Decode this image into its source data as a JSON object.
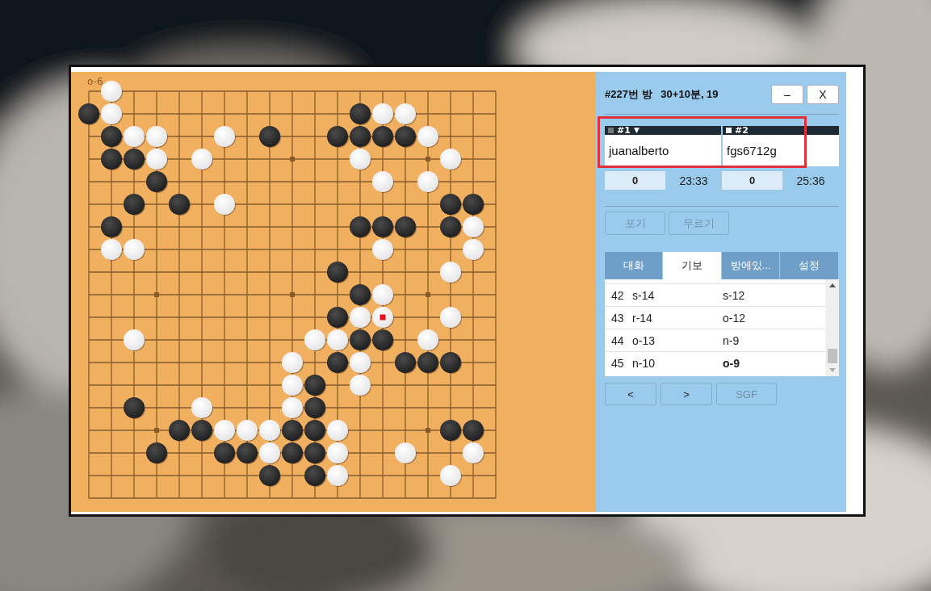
{
  "board": {
    "hover_label": "o-6",
    "rows": [
      {
        "points": [
          {
            "kind": "none"
          },
          {
            "kind": "white"
          },
          {
            "kind": "none"
          },
          {
            "kind": "none"
          },
          {
            "kind": "none"
          },
          {
            "kind": "none"
          },
          {
            "kind": "none"
          },
          {
            "kind": "none"
          },
          {
            "kind": "none"
          },
          {
            "kind": "none"
          },
          {
            "kind": "none"
          },
          {
            "kind": "none"
          },
          {
            "kind": "none"
          },
          {
            "kind": "none"
          },
          {
            "kind": "none"
          },
          {
            "kind": "none"
          },
          {
            "kind": "none"
          },
          {
            "kind": "none"
          },
          {
            "kind": "none"
          }
        ]
      },
      {
        "points": [
          {
            "kind": "black"
          },
          {
            "kind": "white"
          },
          {
            "kind": "none"
          },
          {
            "kind": "none"
          },
          {
            "kind": "none"
          },
          {
            "kind": "none"
          },
          {
            "kind": "none"
          },
          {
            "kind": "none"
          },
          {
            "kind": "none"
          },
          {
            "kind": "none"
          },
          {
            "kind": "none"
          },
          {
            "kind": "none"
          },
          {
            "kind": "black"
          },
          {
            "kind": "white"
          },
          {
            "kind": "white"
          },
          {
            "kind": "none"
          },
          {
            "kind": "none"
          },
          {
            "kind": "none"
          },
          {
            "kind": "none"
          }
        ]
      },
      {
        "points": [
          {
            "kind": "none"
          },
          {
            "kind": "black"
          },
          {
            "kind": "white"
          },
          {
            "kind": "white"
          },
          {
            "kind": "none"
          },
          {
            "kind": "none"
          },
          {
            "kind": "white"
          },
          {
            "kind": "none"
          },
          {
            "kind": "black"
          },
          {
            "kind": "none"
          },
          {
            "kind": "none"
          },
          {
            "kind": "black"
          },
          {
            "kind": "black"
          },
          {
            "kind": "black"
          },
          {
            "kind": "black"
          },
          {
            "kind": "white"
          },
          {
            "kind": "none"
          },
          {
            "kind": "none"
          },
          {
            "kind": "none"
          }
        ]
      },
      {
        "points": [
          {
            "kind": "none"
          },
          {
            "kind": "black"
          },
          {
            "kind": "black"
          },
          {
            "kind": "white"
          },
          {
            "kind": "none"
          },
          {
            "kind": "white"
          },
          {
            "kind": "none"
          },
          {
            "kind": "none"
          },
          {
            "kind": "none"
          },
          {
            "kind": "none"
          },
          {
            "kind": "none"
          },
          {
            "kind": "none"
          },
          {
            "kind": "white"
          },
          {
            "kind": "none"
          },
          {
            "kind": "none"
          },
          {
            "kind": "none"
          },
          {
            "kind": "white"
          },
          {
            "kind": "none"
          },
          {
            "kind": "none"
          }
        ]
      },
      {
        "points": [
          {
            "kind": "none"
          },
          {
            "kind": "none"
          },
          {
            "kind": "none"
          },
          {
            "kind": "black"
          },
          {
            "kind": "none"
          },
          {
            "kind": "none"
          },
          {
            "kind": "none"
          },
          {
            "kind": "none"
          },
          {
            "kind": "none"
          },
          {
            "kind": "none"
          },
          {
            "kind": "none"
          },
          {
            "kind": "none"
          },
          {
            "kind": "none"
          },
          {
            "kind": "white"
          },
          {
            "kind": "none"
          },
          {
            "kind": "white"
          },
          {
            "kind": "none"
          },
          {
            "kind": "none"
          },
          {
            "kind": "none"
          }
        ]
      },
      {
        "points": [
          {
            "kind": "none"
          },
          {
            "kind": "none"
          },
          {
            "kind": "black"
          },
          {
            "kind": "none"
          },
          {
            "kind": "black"
          },
          {
            "kind": "none"
          },
          {
            "kind": "white"
          },
          {
            "kind": "none"
          },
          {
            "kind": "none"
          },
          {
            "kind": "none"
          },
          {
            "kind": "none"
          },
          {
            "kind": "none"
          },
          {
            "kind": "none"
          },
          {
            "kind": "none"
          },
          {
            "kind": "none"
          },
          {
            "kind": "none"
          },
          {
            "kind": "black"
          },
          {
            "kind": "black"
          },
          {
            "kind": "none"
          }
        ]
      },
      {
        "points": [
          {
            "kind": "none"
          },
          {
            "kind": "black"
          },
          {
            "kind": "none"
          },
          {
            "kind": "none"
          },
          {
            "kind": "none"
          },
          {
            "kind": "none"
          },
          {
            "kind": "none"
          },
          {
            "kind": "none"
          },
          {
            "kind": "none"
          },
          {
            "kind": "none"
          },
          {
            "kind": "none"
          },
          {
            "kind": "none"
          },
          {
            "kind": "black"
          },
          {
            "kind": "black"
          },
          {
            "kind": "black"
          },
          {
            "kind": "none"
          },
          {
            "kind": "black"
          },
          {
            "kind": "white"
          },
          {
            "kind": "none"
          }
        ]
      },
      {
        "points": [
          {
            "kind": "none"
          },
          {
            "kind": "white"
          },
          {
            "kind": "white"
          },
          {
            "kind": "none"
          },
          {
            "kind": "none"
          },
          {
            "kind": "none"
          },
          {
            "kind": "none"
          },
          {
            "kind": "none"
          },
          {
            "kind": "none"
          },
          {
            "kind": "none"
          },
          {
            "kind": "none"
          },
          {
            "kind": "none"
          },
          {
            "kind": "none"
          },
          {
            "kind": "white"
          },
          {
            "kind": "none"
          },
          {
            "kind": "none"
          },
          {
            "kind": "none"
          },
          {
            "kind": "white"
          },
          {
            "kind": "none"
          }
        ]
      },
      {
        "points": [
          {
            "kind": "none"
          },
          {
            "kind": "none"
          },
          {
            "kind": "none"
          },
          {
            "kind": "none"
          },
          {
            "kind": "none"
          },
          {
            "kind": "none"
          },
          {
            "kind": "none"
          },
          {
            "kind": "none"
          },
          {
            "kind": "none"
          },
          {
            "kind": "none"
          },
          {
            "kind": "none"
          },
          {
            "kind": "black"
          },
          {
            "kind": "none"
          },
          {
            "kind": "none"
          },
          {
            "kind": "none"
          },
          {
            "kind": "none"
          },
          {
            "kind": "white"
          },
          {
            "kind": "none"
          },
          {
            "kind": "none"
          }
        ]
      },
      {
        "points": [
          {
            "kind": "none"
          },
          {
            "kind": "none"
          },
          {
            "kind": "none"
          },
          {
            "kind": "none"
          },
          {
            "kind": "none"
          },
          {
            "kind": "none"
          },
          {
            "kind": "none"
          },
          {
            "kind": "none"
          },
          {
            "kind": "none"
          },
          {
            "kind": "none"
          },
          {
            "kind": "none"
          },
          {
            "kind": "none"
          },
          {
            "kind": "black"
          },
          {
            "kind": "white"
          },
          {
            "kind": "none"
          },
          {
            "kind": "none"
          },
          {
            "kind": "none"
          },
          {
            "kind": "none"
          },
          {
            "kind": "none"
          }
        ]
      },
      {
        "points": [
          {
            "kind": "none"
          },
          {
            "kind": "none"
          },
          {
            "kind": "none"
          },
          {
            "kind": "none"
          },
          {
            "kind": "none"
          },
          {
            "kind": "none"
          },
          {
            "kind": "none"
          },
          {
            "kind": "none"
          },
          {
            "kind": "none"
          },
          {
            "kind": "none"
          },
          {
            "kind": "none"
          },
          {
            "kind": "black"
          },
          {
            "kind": "white"
          },
          {
            "kind": "white",
            "last": true
          },
          {
            "kind": "none"
          },
          {
            "kind": "none"
          },
          {
            "kind": "white"
          },
          {
            "kind": "none"
          },
          {
            "kind": "none"
          }
        ]
      },
      {
        "points": [
          {
            "kind": "none"
          },
          {
            "kind": "none"
          },
          {
            "kind": "white"
          },
          {
            "kind": "none"
          },
          {
            "kind": "none"
          },
          {
            "kind": "none"
          },
          {
            "kind": "none"
          },
          {
            "kind": "none"
          },
          {
            "kind": "none"
          },
          {
            "kind": "none"
          },
          {
            "kind": "white"
          },
          {
            "kind": "white"
          },
          {
            "kind": "black"
          },
          {
            "kind": "black"
          },
          {
            "kind": "none"
          },
          {
            "kind": "white"
          },
          {
            "kind": "none"
          },
          {
            "kind": "none"
          },
          {
            "kind": "none"
          }
        ]
      },
      {
        "points": [
          {
            "kind": "none"
          },
          {
            "kind": "none"
          },
          {
            "kind": "none"
          },
          {
            "kind": "none"
          },
          {
            "kind": "none"
          },
          {
            "kind": "none"
          },
          {
            "kind": "none"
          },
          {
            "kind": "none"
          },
          {
            "kind": "none"
          },
          {
            "kind": "white"
          },
          {
            "kind": "none"
          },
          {
            "kind": "black"
          },
          {
            "kind": "white"
          },
          {
            "kind": "none"
          },
          {
            "kind": "black"
          },
          {
            "kind": "black"
          },
          {
            "kind": "black"
          },
          {
            "kind": "none"
          },
          {
            "kind": "none"
          }
        ]
      },
      {
        "points": [
          {
            "kind": "none"
          },
          {
            "kind": "none"
          },
          {
            "kind": "none"
          },
          {
            "kind": "none"
          },
          {
            "kind": "none"
          },
          {
            "kind": "none"
          },
          {
            "kind": "none"
          },
          {
            "kind": "none"
          },
          {
            "kind": "none"
          },
          {
            "kind": "white"
          },
          {
            "kind": "black"
          },
          {
            "kind": "none"
          },
          {
            "kind": "white"
          },
          {
            "kind": "none"
          },
          {
            "kind": "none"
          },
          {
            "kind": "none"
          },
          {
            "kind": "none"
          },
          {
            "kind": "none"
          },
          {
            "kind": "none"
          }
        ]
      },
      {
        "points": [
          {
            "kind": "none"
          },
          {
            "kind": "none"
          },
          {
            "kind": "black"
          },
          {
            "kind": "none"
          },
          {
            "kind": "none"
          },
          {
            "kind": "white"
          },
          {
            "kind": "none"
          },
          {
            "kind": "none"
          },
          {
            "kind": "none"
          },
          {
            "kind": "white"
          },
          {
            "kind": "black"
          },
          {
            "kind": "none"
          },
          {
            "kind": "none"
          },
          {
            "kind": "none"
          },
          {
            "kind": "none"
          },
          {
            "kind": "none"
          },
          {
            "kind": "none"
          },
          {
            "kind": "none"
          },
          {
            "kind": "none"
          }
        ]
      },
      {
        "points": [
          {
            "kind": "none"
          },
          {
            "kind": "none"
          },
          {
            "kind": "none"
          },
          {
            "kind": "none"
          },
          {
            "kind": "black"
          },
          {
            "kind": "black"
          },
          {
            "kind": "white"
          },
          {
            "kind": "white"
          },
          {
            "kind": "white"
          },
          {
            "kind": "black"
          },
          {
            "kind": "black"
          },
          {
            "kind": "white"
          },
          {
            "kind": "none"
          },
          {
            "kind": "none"
          },
          {
            "kind": "none"
          },
          {
            "kind": "none"
          },
          {
            "kind": "black"
          },
          {
            "kind": "black"
          },
          {
            "kind": "none"
          }
        ]
      },
      {
        "points": [
          {
            "kind": "none"
          },
          {
            "kind": "none"
          },
          {
            "kind": "none"
          },
          {
            "kind": "black"
          },
          {
            "kind": "none"
          },
          {
            "kind": "none"
          },
          {
            "kind": "black"
          },
          {
            "kind": "black"
          },
          {
            "kind": "white"
          },
          {
            "kind": "black"
          },
          {
            "kind": "black"
          },
          {
            "kind": "white"
          },
          {
            "kind": "none"
          },
          {
            "kind": "none"
          },
          {
            "kind": "white"
          },
          {
            "kind": "none"
          },
          {
            "kind": "none"
          },
          {
            "kind": "white"
          },
          {
            "kind": "none"
          }
        ]
      },
      {
        "points": [
          {
            "kind": "none"
          },
          {
            "kind": "none"
          },
          {
            "kind": "none"
          },
          {
            "kind": "none"
          },
          {
            "kind": "none"
          },
          {
            "kind": "none"
          },
          {
            "kind": "none"
          },
          {
            "kind": "none"
          },
          {
            "kind": "black"
          },
          {
            "kind": "none"
          },
          {
            "kind": "black"
          },
          {
            "kind": "white"
          },
          {
            "kind": "none"
          },
          {
            "kind": "none"
          },
          {
            "kind": "none"
          },
          {
            "kind": "none"
          },
          {
            "kind": "white"
          },
          {
            "kind": "none"
          },
          {
            "kind": "none"
          }
        ]
      },
      {
        "points": [
          {
            "kind": "none"
          },
          {
            "kind": "none"
          },
          {
            "kind": "none"
          },
          {
            "kind": "none"
          },
          {
            "kind": "none"
          },
          {
            "kind": "none"
          },
          {
            "kind": "none"
          },
          {
            "kind": "none"
          },
          {
            "kind": "none"
          },
          {
            "kind": "none"
          },
          {
            "kind": "none"
          },
          {
            "kind": "none"
          },
          {
            "kind": "none"
          },
          {
            "kind": "none"
          },
          {
            "kind": "none"
          },
          {
            "kind": "none"
          },
          {
            "kind": "none"
          },
          {
            "kind": "none"
          },
          {
            "kind": "none"
          }
        ]
      }
    ]
  },
  "panel": {
    "title": "#227번 방   30+10분, 19",
    "window_buttons": [
      {
        "label": "–"
      },
      {
        "label": "X"
      }
    ],
    "players": [
      {
        "tag": "#1",
        "menu": "▼",
        "kind": "black",
        "name": "juanalberto",
        "score": "0",
        "time": "23:33"
      },
      {
        "tag": "#2",
        "kind": "white",
        "name": "fgs6712g",
        "score": "0",
        "time": "25:36"
      }
    ],
    "actions": [
      {
        "label": "포기",
        "disabled": true
      },
      {
        "label": "무르기",
        "disabled": true
      }
    ],
    "tabs": [
      {
        "label": "대화",
        "selected": false
      },
      {
        "label": "기보",
        "selected": true
      },
      {
        "label": "방에있...",
        "selected": false
      },
      {
        "label": "설정",
        "selected": false
      }
    ],
    "moves": [
      {
        "number": "42",
        "black": "s-14",
        "white": "s-12",
        "last": false
      },
      {
        "number": "43",
        "black": "r-14",
        "white": "o-12",
        "last": false
      },
      {
        "number": "44",
        "black": "o-13",
        "white": "n-9",
        "last": false
      },
      {
        "number": "45",
        "black": "n-10",
        "white": "o-9",
        "last": true
      }
    ],
    "nav": [
      {
        "label": "<",
        "disabled": false
      },
      {
        "label": ">",
        "disabled": false
      },
      {
        "label": "SGF",
        "disabled": true
      }
    ]
  },
  "highlight": {
    "kind": "frame"
  }
}
